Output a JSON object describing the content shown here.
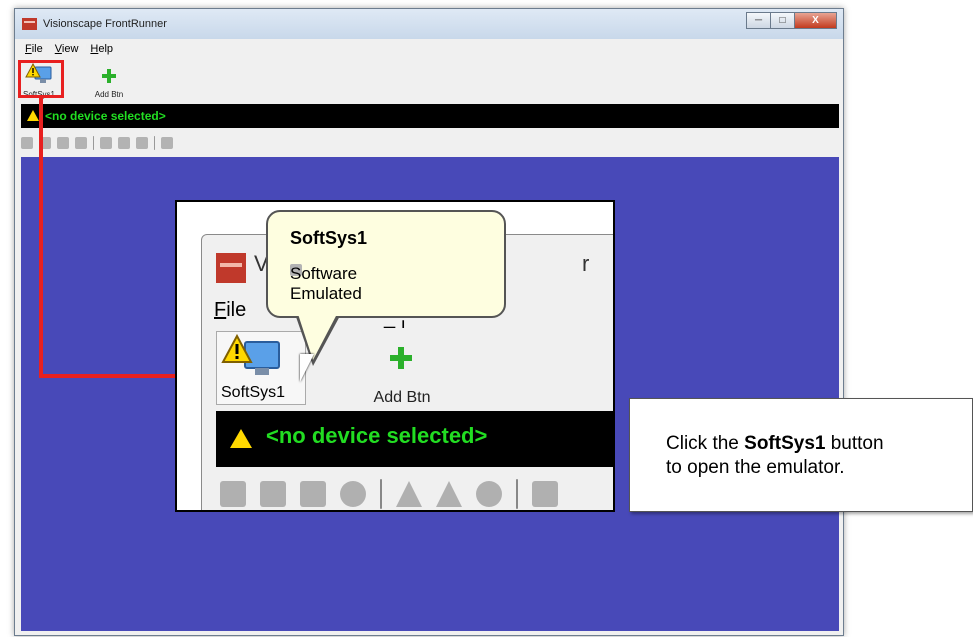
{
  "window": {
    "title": "Visionscape FrontRunner",
    "controls": [
      "─",
      "□",
      "X"
    ]
  },
  "menu": {
    "items": [
      "File",
      "View",
      "Help"
    ]
  },
  "toolbar": {
    "softsys_label": "SoftSys1",
    "addbtn_label": "Add Btn"
  },
  "status": {
    "text": "<no device selected>"
  },
  "zoom": {
    "title_left": "V",
    "title_right": "r",
    "file_label": "File",
    "menu_fragment": "_ ¦",
    "softsys_label": "SoftSys1",
    "addbtn_label": "Add Btn",
    "status_text": "<no device selected>"
  },
  "tooltip": {
    "title": "SoftSys1",
    "subtitle": "Software Emulated"
  },
  "note": {
    "line1_prefix": "Click the ",
    "line1_bold": "SoftSys1",
    "line1_suffix": " button",
    "line2": "to open the emulator."
  },
  "colors": {
    "canvas": "#4849b8",
    "highlight": "#e82020",
    "status_text": "#22dd22",
    "warning": "#ffd800",
    "tooltip_bg": "#fefee0"
  }
}
